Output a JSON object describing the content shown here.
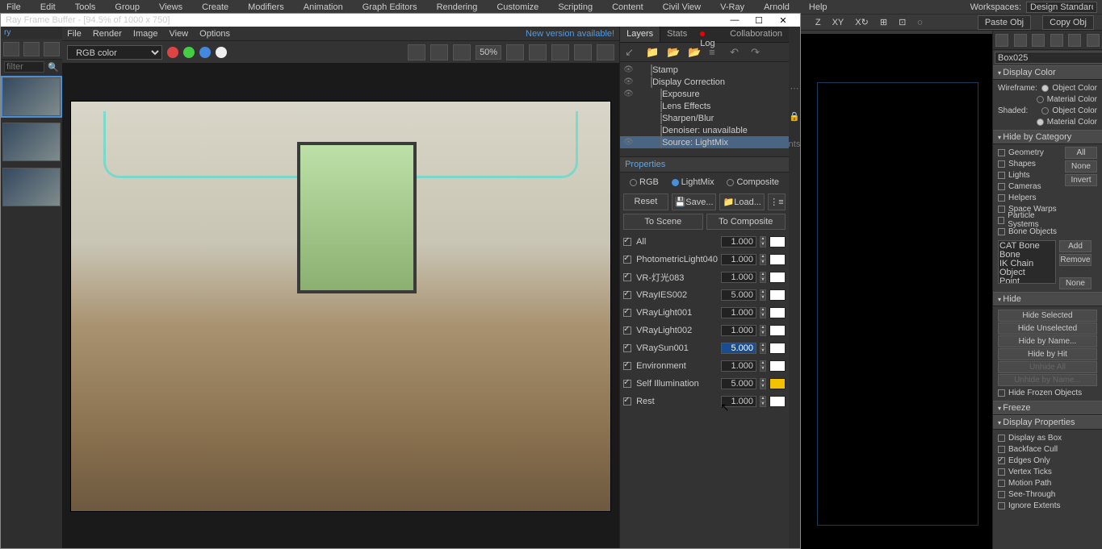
{
  "mainMenu": [
    "File",
    "Edit",
    "Tools",
    "Group",
    "Views",
    "Create",
    "Modifiers",
    "Animation",
    "Graph Editors",
    "Rendering",
    "Customize",
    "Scripting",
    "Content",
    "Civil View",
    "V-Ray",
    "Arnold",
    "Help"
  ],
  "workspace": {
    "label": "Workspaces:",
    "value": "Design Standard"
  },
  "coordBar": {
    "z": "Z",
    "xy": "XY",
    "paste": "Paste Obj",
    "copy": "Copy Obj"
  },
  "vfb": {
    "title": "Ray Frame Buffer - [94.5% of 1000 x 750]",
    "historyLabel": "ry",
    "fileMenu": [
      "File",
      "Render",
      "Image",
      "View",
      "Options"
    ],
    "newVersion": "New version available!",
    "channel": "RGB color",
    "zoom": "50%",
    "tabs": [
      "Layers",
      "Stats",
      "Log",
      "Collaboration"
    ],
    "tree": [
      {
        "label": "Stamp",
        "indent": "indent1",
        "eye": true
      },
      {
        "label": "Display Correction",
        "indent": "indent1",
        "eye": true,
        "check": true
      },
      {
        "label": "Exposure",
        "indent": "indent2",
        "eye": true
      },
      {
        "label": "Lens Effects",
        "indent": "indent2",
        "eye": false
      },
      {
        "label": "Sharpen/Blur",
        "indent": "indent2",
        "eye": false
      },
      {
        "label": "Denoiser: unavailable",
        "indent": "indent2",
        "eye": false
      },
      {
        "label": "Source: LightMix",
        "indent": "indent2",
        "eye": true,
        "selected": true
      }
    ],
    "propsHeader": "Properties",
    "modes": {
      "rgb": "RGB",
      "lightmix": "LightMix",
      "composite": "Composite"
    },
    "buttons": {
      "reset": "Reset",
      "save": "Save...",
      "load": "Load...",
      "toScene": "To Scene",
      "toComposite": "To Composite"
    },
    "lights": [
      {
        "name": "All",
        "val": "1.000",
        "color": "#ffffff"
      },
      {
        "name": "PhotometricLight040",
        "val": "1.000",
        "color": "#ffffff"
      },
      {
        "name": "VR-灯光083",
        "val": "1.000",
        "color": "#ffffff"
      },
      {
        "name": "VRayIES002",
        "val": "5.000",
        "color": "#ffffff"
      },
      {
        "name": "VRayLight001",
        "val": "1.000",
        "color": "#ffffff"
      },
      {
        "name": "VRayLight002",
        "val": "1.000",
        "color": "#ffffff"
      },
      {
        "name": "VRaySun001",
        "val": "5.000",
        "color": "#ffffff",
        "selected": true
      },
      {
        "name": "Environment",
        "val": "1.000",
        "color": "#ffffff"
      },
      {
        "name": "Self Illumination",
        "val": "5.000",
        "color": "#f2c200"
      },
      {
        "name": "Rest",
        "val": "1.000",
        "color": "#ffffff"
      }
    ]
  },
  "cmdPanel": {
    "objectName": "Box025",
    "displayColor": {
      "header": "Display Color",
      "wireframe": "Wireframe:",
      "shaded": "Shaded:",
      "objColor": "Object Color",
      "matColor": "Material Color"
    },
    "hideByCat": {
      "header": "Hide by Category",
      "items": [
        "Geometry",
        "Shapes",
        "Lights",
        "Cameras",
        "Helpers",
        "Space Warps",
        "Particle Systems",
        "Bone Objects"
      ],
      "buttons": {
        "all": "All",
        "none": "None",
        "invert": "Invert",
        "add": "Add",
        "remove": "Remove",
        "none2": "None"
      },
      "list": [
        "CAT Bone",
        "Bone",
        "IK Chain Object",
        "Point"
      ]
    },
    "hide": {
      "header": "Hide",
      "buttons": [
        "Hide Selected",
        "Hide Unselected",
        "Hide by Name...",
        "Hide by Hit",
        "Unhide All",
        "Unhide by Name..."
      ],
      "frozen": "Hide Frozen Objects"
    },
    "freeze": {
      "header": "Freeze"
    },
    "displayProps": {
      "header": "Display Properties",
      "items": [
        "Display as Box",
        "Backface Cull",
        "Edges Only",
        "Vertex Ticks",
        "Motion Path",
        "See-Through",
        "Ignore Extents"
      ],
      "checked": [
        2
      ]
    }
  }
}
